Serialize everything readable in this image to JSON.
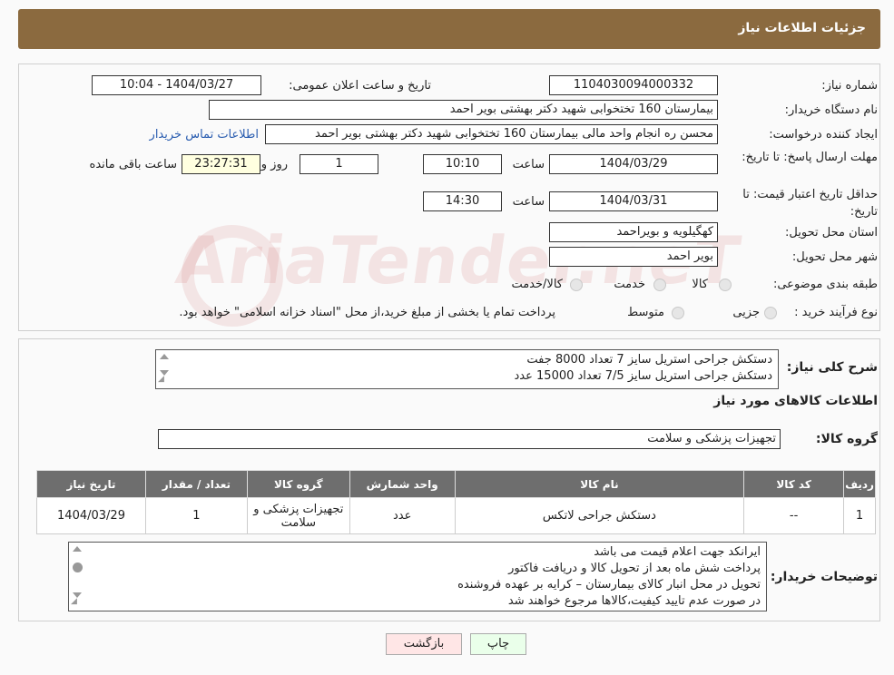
{
  "header": {
    "title": "جزئیات اطلاعات نیاز"
  },
  "form": {
    "need_number_label": "شماره نیاز:",
    "need_number": "1104030094000332",
    "announce_label": "تاریخ و ساعت اعلان عمومی:",
    "announce_value": "1404/03/27 - 10:04",
    "buyer_org_label": "نام دستگاه خریدار:",
    "buyer_org": "بیمارستان 160 تختخوابی شهید دکتر بهشتی بویر احمد",
    "requester_label": "ایجاد کننده درخواست:",
    "requester": "محسن ره انجام واحد مالی بیمارستان 160 تختخوابی شهید دکتر بهشتی بویر احمد",
    "contact_link": "اطلاعات تماس خریدار",
    "deadline_label": "مهلت ارسال پاسخ: تا تاریخ:",
    "deadline_date": "1404/03/29",
    "time_label": "ساعت",
    "deadline_time": "10:10",
    "days_value": "1",
    "days_label": "روز و",
    "remaining_time": "23:27:31",
    "remaining_label": "ساعت باقی مانده",
    "validity_label": "حداقل تاریخ اعتبار قیمت: تا تاریخ:",
    "validity_date": "1404/03/31",
    "validity_time": "14:30",
    "province_label": "استان محل تحویل:",
    "province": "کهگیلویه و بویراحمد",
    "city_label": "شهر محل تحویل:",
    "city": "بویر احمد",
    "category_label": "طبقه بندی موضوعی:",
    "category_options": [
      "کالا",
      "خدمت",
      "کالا/خدمت"
    ],
    "process_label": "نوع فرآیند خرید :",
    "process_options": [
      "جزیی",
      "متوسط"
    ],
    "process_note": "پرداخت تمام یا بخشی از مبلغ خرید،از محل \"اسناد خزانه اسلامی\" خواهد بود."
  },
  "watermark": {
    "text": "AriaTender.neT"
  },
  "summary": {
    "label": "شرح کلی نیاز:",
    "lines": [
      "دستکش جراحی استریل سایز 7 تعداد 8000 جفت",
      "دستکش جراحی استریل سایز 7/5 تعداد 15000 عدد"
    ]
  },
  "items_section": {
    "title": "اطلاعات کالاهای مورد نیاز",
    "group_label": "گروه کالا:",
    "group_value": "تجهیزات پزشکی و سلامت",
    "columns": [
      "ردیف",
      "کد کالا",
      "نام کالا",
      "واحد شمارش",
      "گروه کالا",
      "تعداد / مقدار",
      "تاریخ نیاز"
    ],
    "rows": [
      [
        "1",
        "--",
        "دستکش جراحی لاتکس",
        "عدد",
        "تجهیزات پزشکی و سلامت",
        "1",
        "1404/03/29"
      ]
    ]
  },
  "buyer_notes": {
    "label": "توضیحات خریدار:",
    "lines": [
      "ایرانکد جهت اعلام قیمت می باشد",
      "پرداخت شش ماه بعد از تحویل کالا و دریافت فاکتور",
      "تحویل در محل انبار کالای بیمارستان – کرایه بر عهده فروشنده",
      "در صورت عدم تایید کیفیت،کالاها مرجوع خواهند شد"
    ]
  },
  "buttons": {
    "print": "چاپ",
    "back": "بازگشت"
  },
  "colors": {
    "header_bg": "#8b6a3f",
    "table_header_bg": "#6e6e6e",
    "link": "#2a5db0"
  }
}
